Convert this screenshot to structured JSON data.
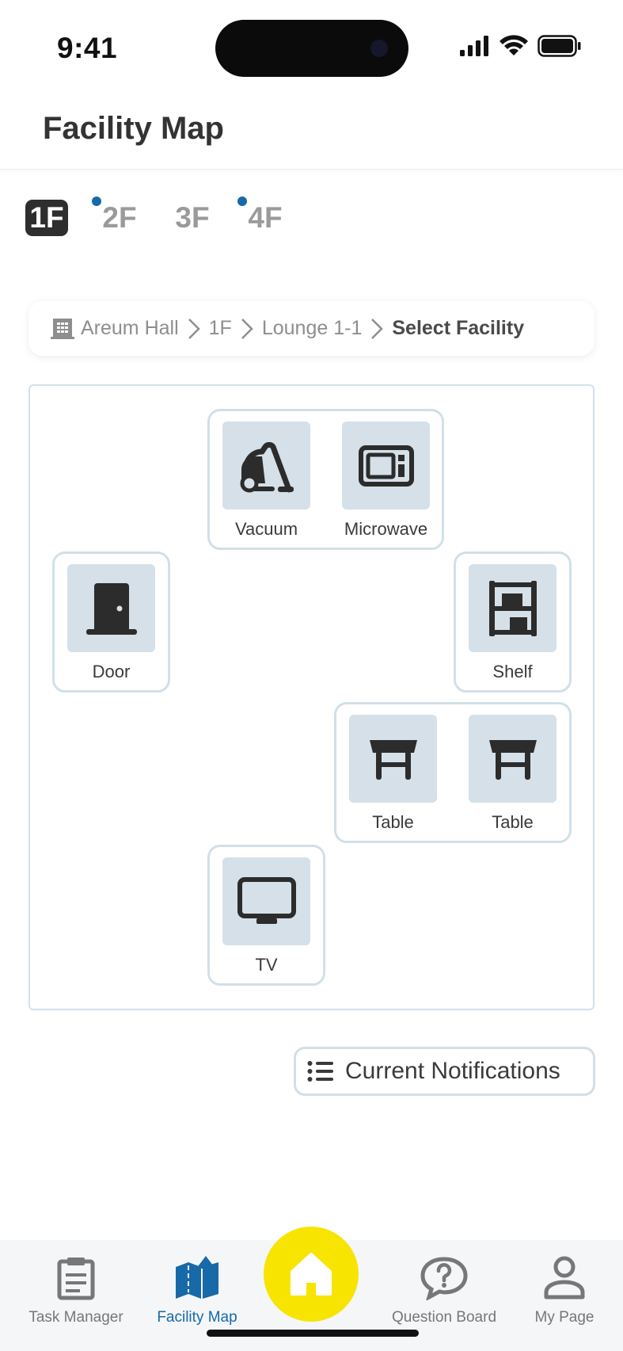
{
  "status": {
    "time": "9:41"
  },
  "header": {
    "title": "Facility Map"
  },
  "floors": [
    {
      "label": "1F",
      "active": true,
      "dot": false
    },
    {
      "label": "2F",
      "active": false,
      "dot": true
    },
    {
      "label": "3F",
      "active": false,
      "dot": false
    },
    {
      "label": "4F",
      "active": false,
      "dot": true
    }
  ],
  "breadcrumb": {
    "building": "Areum Hall",
    "floor": "1F",
    "room": "Lounge 1-1",
    "current": "Select Facility"
  },
  "facilities": {
    "vacuum": "Vacuum",
    "microwave": "Microwave",
    "door": "Door",
    "shelf": "Shelf",
    "table1": "Table",
    "table2": "Table",
    "tv": "TV"
  },
  "notifications_button": "Current Notifications",
  "tabbar": {
    "task_manager": "Task Manager",
    "facility_map": "Facility Map",
    "question_board": "Question Board",
    "my_page": "My Page"
  },
  "colors": {
    "accent": "#1769a8",
    "home_button": "#f7e400",
    "tile": "#d6e0e8",
    "border": "#d2dfe8"
  }
}
